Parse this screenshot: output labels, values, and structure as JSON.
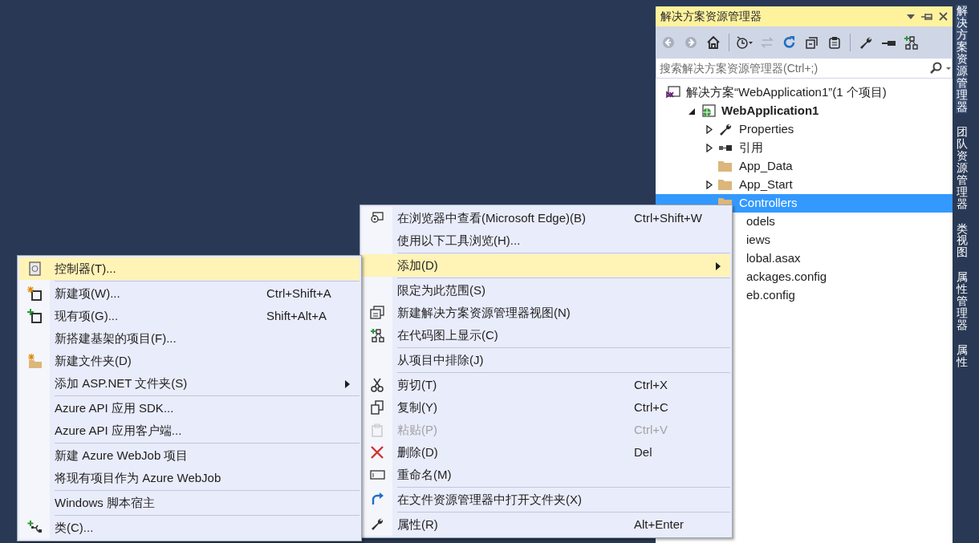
{
  "explorer": {
    "title": "解决方案资源管理器",
    "search": {
      "placeholder": "搜索解决方案资源管理器(Ctrl+;)"
    },
    "toolbar": [
      {
        "kind": "back",
        "disabled": true
      },
      {
        "kind": "forward",
        "disabled": true
      },
      {
        "kind": "home",
        "disabled": false
      },
      {
        "kind": "separator"
      },
      {
        "kind": "history",
        "disabled": false
      },
      {
        "kind": "sync",
        "disabled": true
      },
      {
        "kind": "refresh",
        "disabled": false
      },
      {
        "kind": "collapse",
        "disabled": false
      },
      {
        "kind": "show-files",
        "disabled": false
      },
      {
        "kind": "separator"
      },
      {
        "kind": "properties",
        "disabled": false
      },
      {
        "kind": "preview",
        "disabled": false
      },
      {
        "kind": "code-map",
        "disabled": false
      }
    ],
    "tree": [
      {
        "label": "解决方案“WebApplication1”(1 个项目)",
        "kind": "solution",
        "bold": false,
        "selected": false,
        "children": [
          {
            "label": "WebApplication1",
            "kind": "project",
            "bold": true,
            "expanded": true,
            "selected": false,
            "children": [
              {
                "label": "Properties",
                "kind": "wrench",
                "bold": false,
                "expanded": false,
                "selected": false
              },
              {
                "label": "引用",
                "kind": "references",
                "bold": false,
                "expanded": false,
                "selected": false
              },
              {
                "label": "App_Data",
                "kind": "folder",
                "bold": false,
                "selected": false
              },
              {
                "label": "App_Start",
                "kind": "folder",
                "bold": false,
                "expanded": false,
                "selected": false
              },
              {
                "label": "Controllers",
                "kind": "folder",
                "bold": false,
                "selected": true
              },
              {
                "label": "odels",
                "bold": false,
                "selected": false
              },
              {
                "label": "iews",
                "bold": false,
                "selected": false
              },
              {
                "label": "lobal.asax",
                "bold": false,
                "selected": false
              },
              {
                "label": "ackages.config",
                "bold": false,
                "selected": false
              },
              {
                "label": "eb.config",
                "bold": false,
                "selected": false
              }
            ]
          }
        ]
      }
    ]
  },
  "side_tabs": [
    {
      "label": "解决方案资源管理器",
      "selected": true
    },
    {
      "label": "团队资源管理器",
      "selected": false
    },
    {
      "label": "类视图",
      "selected": false
    },
    {
      "label": "属性管理器",
      "selected": false
    },
    {
      "label": "属性",
      "selected": false
    }
  ],
  "context_menu": [
    {
      "kind": "browser",
      "label": "在浏览器中查看(Microsoft Edge)(B)",
      "shortcut": "Ctrl+Shift+W",
      "selected": false,
      "disabled": false,
      "submenu": false
    },
    {
      "kind": "item",
      "label": "使用以下工具浏览(H)...",
      "selected": false,
      "disabled": false,
      "submenu": false
    },
    {
      "kind": "separator"
    },
    {
      "kind": "item",
      "label": "添加(D)",
      "selected": true,
      "disabled": false,
      "submenu": true
    },
    {
      "kind": "separator"
    },
    {
      "kind": "item",
      "label": "限定为此范围(S)",
      "selected": false,
      "disabled": false,
      "submenu": false
    },
    {
      "kind": "new-view",
      "label": "新建解决方案资源管理器视图(N)",
      "selected": false,
      "disabled": false,
      "submenu": false
    },
    {
      "kind": "code-map",
      "label": "在代码图上显示(C)",
      "selected": false,
      "disabled": false,
      "submenu": false
    },
    {
      "kind": "separator"
    },
    {
      "kind": "item",
      "label": "从项目中排除(J)",
      "selected": false,
      "disabled": false,
      "submenu": false
    },
    {
      "kind": "separator"
    },
    {
      "kind": "cut",
      "label": "剪切(T)",
      "shortcut": "Ctrl+X",
      "selected": false,
      "disabled": false,
      "submenu": false
    },
    {
      "kind": "copy",
      "label": "复制(Y)",
      "shortcut": "Ctrl+C",
      "selected": false,
      "disabled": false,
      "submenu": false
    },
    {
      "kind": "paste",
      "label": "粘贴(P)",
      "shortcut": "Ctrl+V",
      "selected": false,
      "disabled": true,
      "submenu": false
    },
    {
      "kind": "delete",
      "label": "删除(D)",
      "shortcut": "Del",
      "selected": false,
      "disabled": false,
      "submenu": false
    },
    {
      "kind": "rename",
      "label": "重命名(M)",
      "selected": false,
      "disabled": false,
      "submenu": false
    },
    {
      "kind": "separator"
    },
    {
      "kind": "open-folder",
      "label": "在文件资源管理器中打开文件夹(X)",
      "selected": false,
      "disabled": false,
      "submenu": false
    },
    {
      "kind": "separator"
    },
    {
      "kind": "wrench",
      "label": "属性(R)",
      "shortcut": "Alt+Enter",
      "selected": false,
      "disabled": false,
      "submenu": false
    }
  ],
  "add_submenu": [
    {
      "kind": "controller",
      "label": "控制器(T)...",
      "selected": true,
      "disabled": false,
      "submenu": false
    },
    {
      "kind": "separator"
    },
    {
      "kind": "new-item",
      "label": "新建项(W)...",
      "shortcut": "Ctrl+Shift+A",
      "selected": false,
      "disabled": false,
      "submenu": false
    },
    {
      "kind": "existing-item",
      "label": "现有项(G)...",
      "shortcut": "Shift+Alt+A",
      "selected": false,
      "disabled": false,
      "submenu": false
    },
    {
      "kind": "item",
      "label": "新搭建基架的项目(F)...",
      "selected": false,
      "disabled": false,
      "submenu": false
    },
    {
      "kind": "new-folder",
      "label": "新建文件夹(D)",
      "selected": false,
      "disabled": false,
      "submenu": false
    },
    {
      "kind": "item",
      "label": "添加 ASP.NET 文件夹(S)",
      "selected": false,
      "disabled": false,
      "submenu": true
    },
    {
      "kind": "separator"
    },
    {
      "kind": "item",
      "label": "Azure API 应用 SDK...",
      "selected": false,
      "disabled": false,
      "submenu": false
    },
    {
      "kind": "item",
      "label": "Azure API 应用客户端...",
      "selected": false,
      "disabled": false,
      "submenu": false
    },
    {
      "kind": "separator"
    },
    {
      "kind": "item",
      "label": "新建 Azure WebJob 项目",
      "selected": false,
      "disabled": false,
      "submenu": false
    },
    {
      "kind": "item",
      "label": "将现有项目作为 Azure WebJob",
      "selected": false,
      "disabled": false,
      "submenu": false
    },
    {
      "kind": "separator"
    },
    {
      "kind": "item",
      "label": "Windows 脚本宿主",
      "selected": false,
      "disabled": false,
      "submenu": false
    },
    {
      "kind": "separator"
    },
    {
      "kind": "class",
      "label": "类(C)...",
      "selected": false,
      "disabled": false,
      "submenu": false
    }
  ]
}
